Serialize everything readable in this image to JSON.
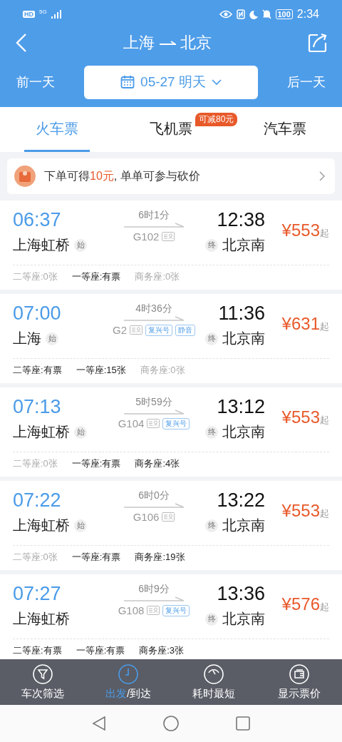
{
  "status_bar": {
    "hd": "HD",
    "network": "5G",
    "battery": "100",
    "time": "2:34"
  },
  "header": {
    "title_from": "上海",
    "title_to": "北京"
  },
  "date_bar": {
    "prev": "前一天",
    "date": "05-27 明天",
    "next": "后一天"
  },
  "tabs": [
    {
      "label": "火车票",
      "selected": true
    },
    {
      "label": "飞机票",
      "selected": false,
      "badge": "可减80元"
    },
    {
      "label": "汽车票",
      "selected": false
    }
  ],
  "promo": {
    "text": "下单可得**10元**, 单单可参与砍价"
  },
  "trains": [
    {
      "depart": "06:37",
      "from": "上海虹桥",
      "from_badge": "始",
      "duration": "6时1分",
      "number": "G102",
      "arrive": "12:38",
      "to_badge": "终",
      "to": "北京南",
      "price": "¥553",
      "price_suffix": "起",
      "seats": [
        {
          "text": "二等座:0张",
          "available": false
        },
        {
          "text": "一等座:有票",
          "available": true
        },
        {
          "text": "商务座:0张",
          "available": false
        }
      ]
    },
    {
      "depart": "07:00",
      "from": "上海",
      "from_badge": "始",
      "duration": "4时36分",
      "number": "G2",
      "tags": [
        "复兴号",
        "静音"
      ],
      "arrive": "11:36",
      "to_badge": "终",
      "to": "北京南",
      "price": "¥631",
      "price_suffix": "起",
      "seats": [
        {
          "text": "二等座:有票",
          "available": true
        },
        {
          "text": "一等座:15张",
          "available": true
        },
        {
          "text": "商务座:0张",
          "available": false
        }
      ]
    },
    {
      "depart": "07:13",
      "from": "上海虹桥",
      "from_badge": "始",
      "duration": "5时59分",
      "number": "G104",
      "tags": [
        "复兴号"
      ],
      "arrive": "13:12",
      "to_badge": "终",
      "to": "北京南",
      "price": "¥553",
      "price_suffix": "起",
      "seats": [
        {
          "text": "二等座:0张",
          "available": false
        },
        {
          "text": "一等座:有票",
          "available": true
        },
        {
          "text": "商务座:4张",
          "available": true
        }
      ]
    },
    {
      "depart": "07:22",
      "from": "上海虹桥",
      "from_badge": "始",
      "duration": "6时0分",
      "number": "G106",
      "arrive": "13:22",
      "to_badge": "终",
      "to": "北京南",
      "price": "¥553",
      "price_suffix": "起",
      "seats": [
        {
          "text": "二等座:0张",
          "available": false
        },
        {
          "text": "一等座:有票",
          "available": true
        },
        {
          "text": "商务座:19张",
          "available": true
        }
      ]
    },
    {
      "depart": "07:27",
      "from": "上海虹桥",
      "duration": "6时9分",
      "number": "G108",
      "tags": [
        "复兴号"
      ],
      "arrive": "13:36",
      "to_badge": "终",
      "to": "北京南",
      "price": "¥576",
      "price_suffix": "起",
      "seats": [
        {
          "text": "二等座:有票",
          "available": true
        },
        {
          "text": "一等座:有票",
          "available": true
        },
        {
          "text": "商务座:3张",
          "available": true
        }
      ]
    }
  ],
  "toolbar": [
    {
      "kind": "filter",
      "label": "车次筛选",
      "selected": false
    },
    {
      "kind": "clock",
      "label": "出发",
      "suffix": "/到达",
      "selected": true
    },
    {
      "kind": "gauge",
      "label": "耗时最短",
      "selected": false
    },
    {
      "kind": "wallet",
      "label": "显示票价",
      "selected": false
    }
  ]
}
